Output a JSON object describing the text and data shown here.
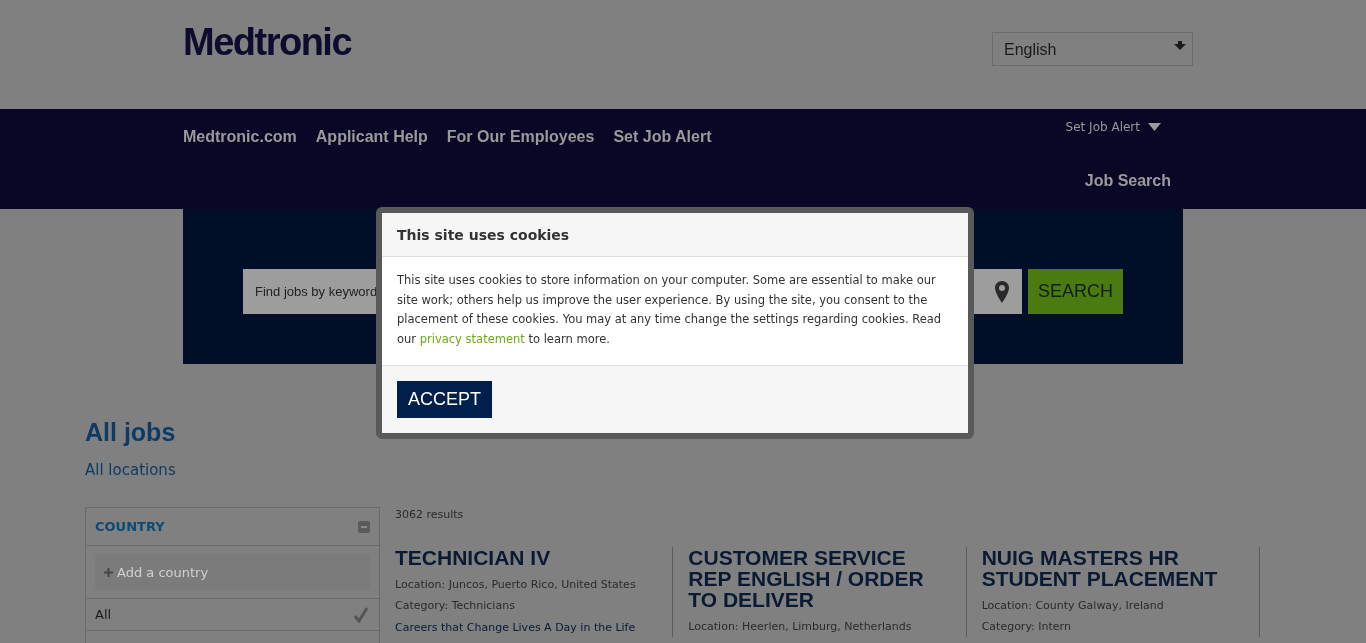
{
  "header": {
    "logo": "Medtronic",
    "language": {
      "value": "English"
    }
  },
  "nav": {
    "links": [
      "Medtronic.com",
      "Applicant Help",
      "For Our Employees",
      "Set Job Alert"
    ],
    "alert_menu": "Set Job Alert",
    "job_search": "Job Search"
  },
  "search": {
    "placeholder": "Find jobs by keyword",
    "button": "SEARCH"
  },
  "cookie_dialog": {
    "title": "This site uses cookies",
    "text_before": "This site uses cookies to store information on your computer. Some are essential to make our site work; others help us improve the user experience. By using the site, you consent to the placement of these cookies. You may at any time change the settings regarding cookies. Read our",
    "link": "privacy statement",
    "text_after": "to learn more.",
    "button": "ACCEPT"
  },
  "heading": "All jobs",
  "subheading": "All locations",
  "filter": {
    "title": "COUNTRY",
    "expanded": true,
    "add_placeholder": "Add a country",
    "options": [
      {
        "label": "All",
        "selected": true
      }
    ]
  },
  "results_count": "3062 results",
  "jobs": [
    {
      "title": "TECHNICIAN IV",
      "details": [
        "Location: Juncos, Puerto Rico, United States",
        "Category: Technicians"
      ],
      "link": "Careers that Change Lives A Day in the Life"
    },
    {
      "title": "CUSTOMER SERVICE REP ENGLISH / ORDER TO DELIVER",
      "details": [
        "Location: Heerlen, Limburg, Netherlands"
      ]
    },
    {
      "title": "NUIG MASTERS HR STUDENT PLACEMENT",
      "details": [
        "Location: County Galway, Ireland",
        "Category: Intern"
      ]
    }
  ]
}
